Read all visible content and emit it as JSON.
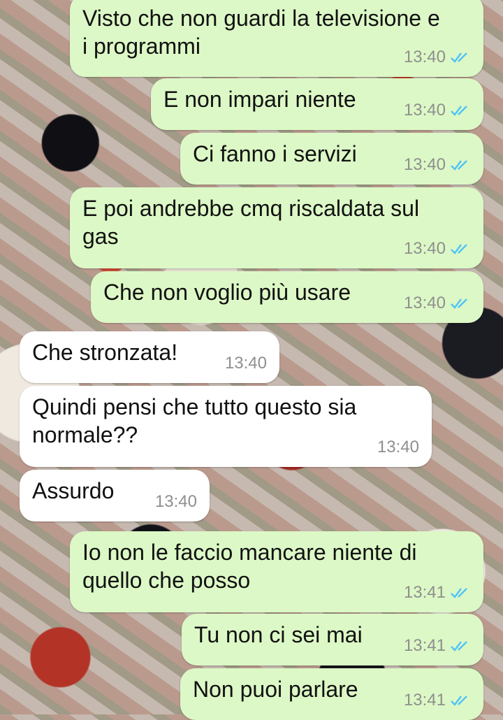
{
  "messages": [
    {
      "direction": "out",
      "text": "Visto che non guardi la televisione e i programmi",
      "time": "13:40",
      "status": "read-ticks-icon"
    },
    {
      "direction": "out",
      "text": "E non impari niente",
      "time": "13:40",
      "status": "read-ticks-icon"
    },
    {
      "direction": "out",
      "text": "Ci fanno i servizi",
      "time": "13:40",
      "status": "read-ticks-icon"
    },
    {
      "direction": "out",
      "text": "E poi andrebbe cmq riscaldata sul gas",
      "time": "13:40",
      "status": "read-ticks-icon"
    },
    {
      "direction": "out",
      "text": "Che non voglio più usare",
      "time": "13:40",
      "status": "read-ticks-icon"
    },
    {
      "direction": "in",
      "text": "Che stronzata!",
      "time": "13:40"
    },
    {
      "direction": "in",
      "text": "Quindi pensi che tutto questo sia normale??",
      "time": "13:40"
    },
    {
      "direction": "in",
      "text": "Assurdo",
      "time": "13:40"
    },
    {
      "direction": "out",
      "text": "Io non le faccio mancare niente di quello che posso",
      "time": "13:41",
      "status": "read-ticks-icon"
    },
    {
      "direction": "out",
      "text": "Tu non ci sei mai",
      "time": "13:41",
      "status": "read-ticks-icon"
    },
    {
      "direction": "out",
      "text": "Non puoi parlare",
      "time": "13:41",
      "status": "read-ticks-icon"
    }
  ],
  "colors": {
    "outgoing_bubble": "#dcf8c6",
    "incoming_bubble": "#ffffff",
    "read_ticks": "#4fc3f7",
    "timestamp": "#8f8f8f"
  }
}
